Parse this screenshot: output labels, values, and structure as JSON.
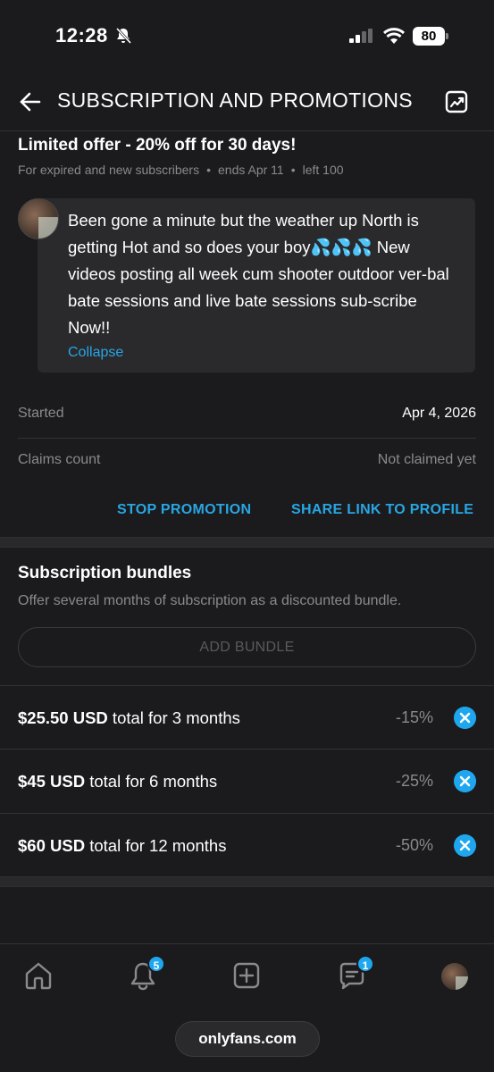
{
  "status_bar": {
    "time": "12:28",
    "battery": "80"
  },
  "header": {
    "title": "SUBSCRIPTION AND PROMOTIONS"
  },
  "offer": {
    "title": "Limited offer - 20% off for 30 days!",
    "audience": "For expired and new subscribers",
    "ends": "ends Apr 11",
    "left": "left 100",
    "message": "Been gone a minute but the weather up North is getting Hot and so does your boy💦💦💦 New videos posting all week cum shooter outdoor ver-bal bate sessions and live bate sessions sub-scribe Now!!",
    "collapse_label": "Collapse",
    "started_label": "Started",
    "started_value": "Apr 4, 2026",
    "claims_label": "Claims count",
    "claims_value": "Not claimed yet",
    "stop_label": "STOP PROMOTION",
    "share_label": "SHARE LINK TO PROFILE"
  },
  "bundles": {
    "title": "Subscription bundles",
    "description": "Offer several months of subscription as a discounted bundle.",
    "add_label": "ADD BUNDLE",
    "items": [
      {
        "price": "$25.50 USD",
        "text": " total for 3 months",
        "discount": "-15%"
      },
      {
        "price": "$45 USD",
        "text": " total for 6 months",
        "discount": "-25%"
      },
      {
        "price": "$60 USD",
        "text": " total for 12 months",
        "discount": "-50%"
      }
    ]
  },
  "bottom_nav": {
    "notifications_badge": "5",
    "messages_badge": "1",
    "items": [
      "home-icon",
      "bell-icon",
      "add-post-icon",
      "messages-icon",
      "profile-avatar"
    ]
  },
  "url": "onlyfans.com",
  "colors": {
    "accent": "#1ea7ef",
    "link": "#28a6e4",
    "background": "#1b1b1d"
  }
}
